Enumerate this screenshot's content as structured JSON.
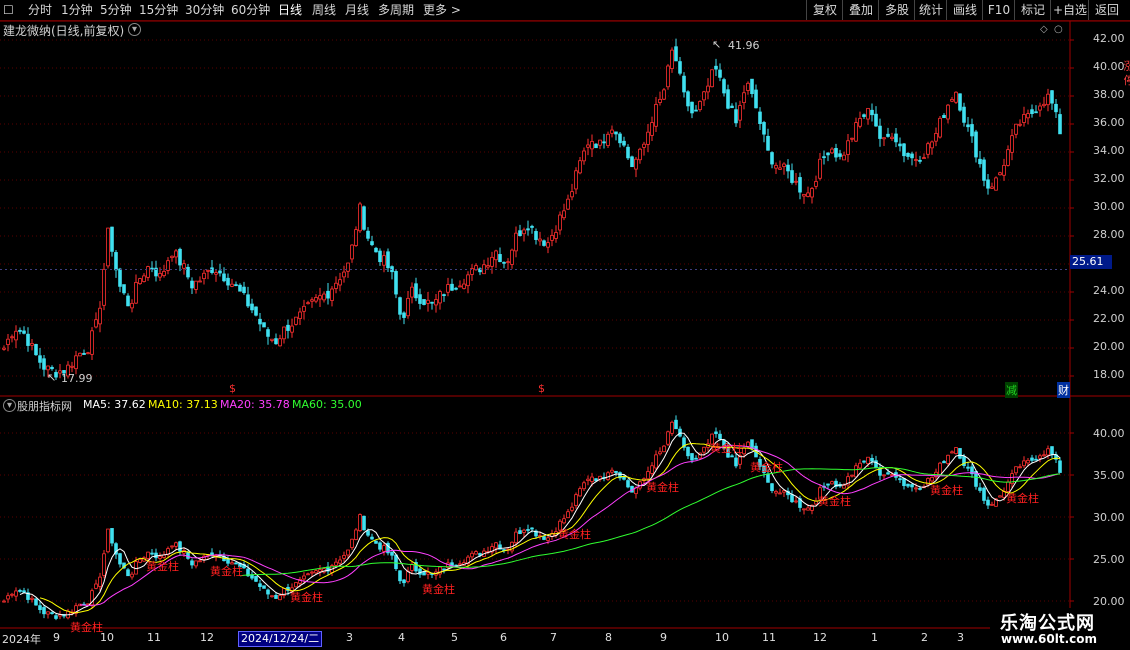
{
  "toolbar": {
    "menu_icon": "☐",
    "periods": [
      "分时",
      "1分钟",
      "5分钟",
      "15分钟",
      "30分钟",
      "60分钟",
      "日线",
      "周线",
      "月线",
      "多周期"
    ],
    "active_period": "日线",
    "more_label": "更多 >",
    "right_buttons": [
      "复权",
      "叠加",
      "多股",
      "统计",
      "画线",
      "F10",
      "标记",
      "+自选",
      "返回"
    ]
  },
  "main_chart": {
    "title": "建龙微纳(日线,前复权)",
    "high_label": "41.96",
    "low_label": "17.99",
    "y_ticks": [
      "42.00",
      "40.00",
      "38.00",
      "36.00",
      "34.00",
      "32.00",
      "30.00",
      "28.00",
      "26.00",
      "24.00",
      "22.00",
      "20.00",
      "18.00"
    ],
    "current_price": "25.61",
    "event_marks": [
      {
        "text": "$",
        "color": "#ff3030"
      },
      {
        "text": "$",
        "color": "#ff3030"
      },
      {
        "text": "减",
        "color": "#20d020"
      },
      {
        "text": "财",
        "color": "#ffffff"
      }
    ],
    "side_text": "涨 停"
  },
  "indicator": {
    "title": "股朋指标网",
    "ma_labels": [
      {
        "text": "MA5: 37.62",
        "color": "#ffffff"
      },
      {
        "text": "MA10: 37.13",
        "color": "#ffff00"
      },
      {
        "text": "MA20: 35.78",
        "color": "#ff40ff"
      },
      {
        "text": "MA60: 35.00",
        "color": "#30ff30"
      }
    ],
    "y_ticks": [
      "40.00",
      "35.00",
      "30.00",
      "25.00",
      "20.00"
    ],
    "signal_text": "黄金柱"
  },
  "time_axis": {
    "year_label": "2024年",
    "selected_date": "2024/12/24/二",
    "months": [
      "9",
      "10",
      "11",
      "12",
      "3",
      "4",
      "5",
      "6",
      "7",
      "8",
      "9",
      "10",
      "11",
      "12",
      "1",
      "2",
      "3"
    ]
  },
  "watermark": {
    "title": "乐淘公式网",
    "url": "www.60lt.com"
  },
  "colors": {
    "up": "#ff3030",
    "down": "#40e0f0",
    "grid": "#5a0000",
    "axis": "#a00000"
  },
  "chart_data": {
    "type": "candlestick",
    "title": "建龙微纳(日线,前复权)",
    "y_range": [
      17,
      43
    ],
    "close_path": [
      20,
      21.5,
      21,
      19.5,
      18.5,
      18.3,
      18.5,
      19.5,
      20,
      22,
      28.5,
      24.5,
      23,
      25,
      26,
      25,
      27,
      26,
      24.5,
      25,
      25.8,
      25.2,
      24.5,
      23.5,
      22.5,
      21,
      20.5,
      21.5,
      22,
      22.8,
      23.5,
      24,
      25,
      26,
      30,
      27.5,
      26.5,
      25.5,
      22,
      24,
      23.5,
      23,
      24,
      24.5,
      25,
      25.5,
      26,
      27,
      26,
      28,
      29,
      28,
      27.5,
      29,
      30.5,
      33,
      35,
      34.5,
      36,
      35,
      33,
      34,
      36.5,
      38,
      41.5,
      38,
      36.5,
      38,
      40,
      38,
      36,
      39,
      37,
      34,
      33,
      32.5,
      31.5,
      31,
      33,
      34.5,
      33.5,
      35,
      36.5,
      37,
      34.5,
      35.5,
      34,
      33.5,
      34,
      35,
      37,
      38.5,
      36,
      34,
      31.5,
      32,
      34,
      36,
      36.5,
      37.5,
      38,
      35.5
    ]
  }
}
